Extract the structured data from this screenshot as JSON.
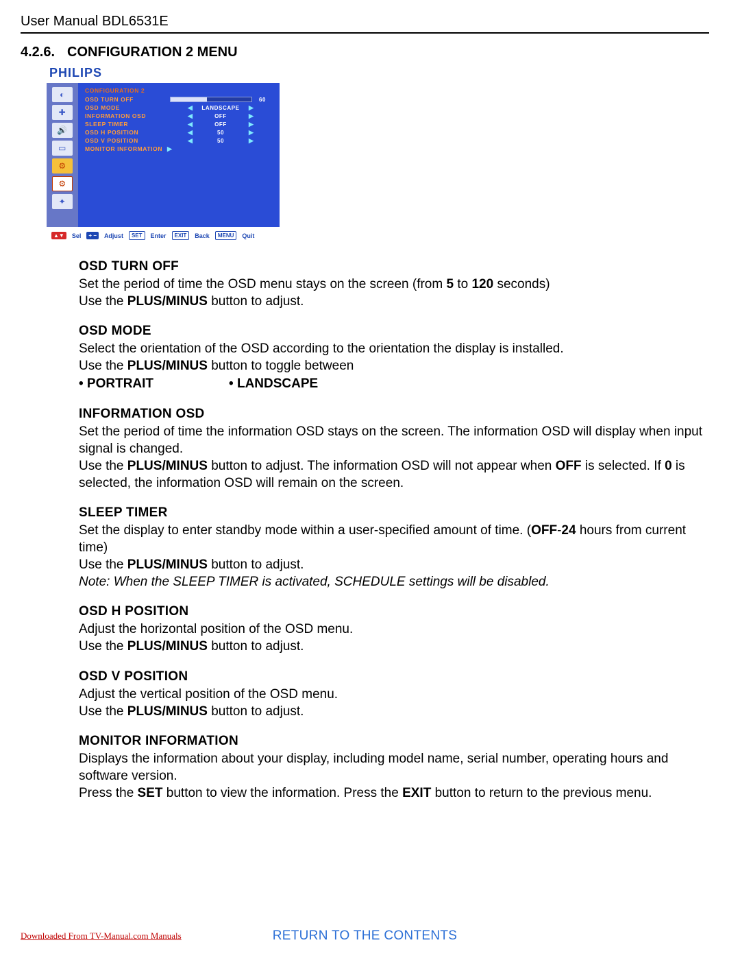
{
  "header": {
    "title": "User Manual BDL6531E"
  },
  "section": {
    "number": "4.2.6.",
    "title": "CONFIGURATION 2 MENU"
  },
  "logo": "PHILIPS",
  "osd": {
    "heading": "CONFIGURATION 2",
    "rows": [
      {
        "label": "OSD TURN OFF",
        "type": "bar",
        "value": "60",
        "fillPct": 45
      },
      {
        "label": "OSD MODE",
        "type": "arrows",
        "value": "LANDSCAPE"
      },
      {
        "label": "INFORMATION OSD",
        "type": "arrows",
        "value": "OFF"
      },
      {
        "label": "SLEEP TIMER",
        "type": "arrows",
        "value": "OFF"
      },
      {
        "label": "OSD H POSITION",
        "type": "arrows",
        "value": "50"
      },
      {
        "label": "OSD V POSITION",
        "type": "arrows",
        "value": "50"
      },
      {
        "label": "MONITOR INFORMATION",
        "type": "enter",
        "value": ""
      }
    ],
    "legend": {
      "sel_badge": "▲▼",
      "sel": "Sel",
      "adj_badge": "+ −",
      "adj": "Adjust",
      "set_badge": "SET",
      "set": "Enter",
      "exit_badge": "EXIT",
      "exit": "Back",
      "menu_badge": "MENU",
      "menu": "Quit"
    }
  },
  "doc": {
    "osd_turn_off": {
      "h": "OSD TURN OFF",
      "p1a": "Set the period of time the OSD menu stays on the screen (from ",
      "b1": "5",
      "p1b": " to ",
      "b2": "120",
      "p1c": " seconds)",
      "p2a": "Use the ",
      "p2b": "PLUS/MINUS",
      "p2c": " button to adjust."
    },
    "osd_mode": {
      "h": "OSD MODE",
      "p1": "Select the orientation of the OSD according to the orientation the display is installed.",
      "p2a": "Use the ",
      "p2b": "PLUS/MINUS",
      "p2c": " button to toggle between",
      "opt1": "• PORTRAIT",
      "opt2": "• LANDSCAPE"
    },
    "info_osd": {
      "h": "INFORMATION OSD",
      "p1": "Set the period of time the information OSD stays on the screen. The information OSD will display when input signal is changed.",
      "p2a": "Use the ",
      "p2b": "PLUS/MINUS",
      "p2c": " button to adjust. The information OSD will not appear when ",
      "p2d": "OFF",
      "p2e": " is selected. If ",
      "p2f": "0",
      "p2g": " is selected, the information OSD will remain on the screen."
    },
    "sleep": {
      "h": "SLEEP TIMER",
      "p1a": "Set the display to enter standby mode within a user-specified amount of time. (",
      "p1b": "OFF",
      "p1c": "-",
      "p1d": "24",
      "p1e": " hours from current time)",
      "p2a": "Use the ",
      "p2b": "PLUS/MINUS",
      "p2c": " button to adjust.",
      "note": "Note: When the SLEEP TIMER is activated, SCHEDULE settings will be disabled."
    },
    "hpos": {
      "h": "OSD H POSITION",
      "p1": "Adjust the horizontal position of the OSD menu.",
      "p2a": "Use the ",
      "p2b": "PLUS/MINUS",
      "p2c": " button to adjust."
    },
    "vpos": {
      "h": "OSD V POSITION",
      "p1": "Adjust the vertical position of the OSD menu.",
      "p2a": "Use the ",
      "p2b": "PLUS/MINUS",
      "p2c": " button to adjust."
    },
    "moninfo": {
      "h": "MONITOR INFORMATION",
      "p1": "Displays the information about your display, including model name, serial number, operating hours and software version.",
      "p2a": "Press the ",
      "p2b": "SET",
      "p2c": " button to view the information. Press the ",
      "p2d": "EXIT",
      "p2e": " button to return to the previous menu."
    }
  },
  "footer": {
    "download": "Downloaded From TV-Manual.com Manuals",
    "return": "RETURN TO THE CONTENTS"
  }
}
